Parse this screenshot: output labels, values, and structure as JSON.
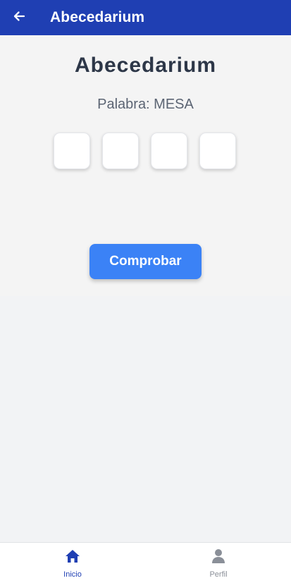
{
  "appbar": {
    "title": "Abecedarium",
    "back_icon": "arrow-left-icon",
    "background": "#1f3fb3"
  },
  "main": {
    "title": "Abecedarium",
    "word_label": "Palabra: MESA",
    "letter_boxes": [
      "",
      "",
      "",
      ""
    ],
    "check_button_label": "Comprobar",
    "accent_color": "#3b82f6"
  },
  "bottom_nav": {
    "items": [
      {
        "label": "Inicio",
        "icon": "home-icon",
        "active": true
      },
      {
        "label": "Perfil",
        "icon": "person-icon",
        "active": false
      }
    ]
  }
}
